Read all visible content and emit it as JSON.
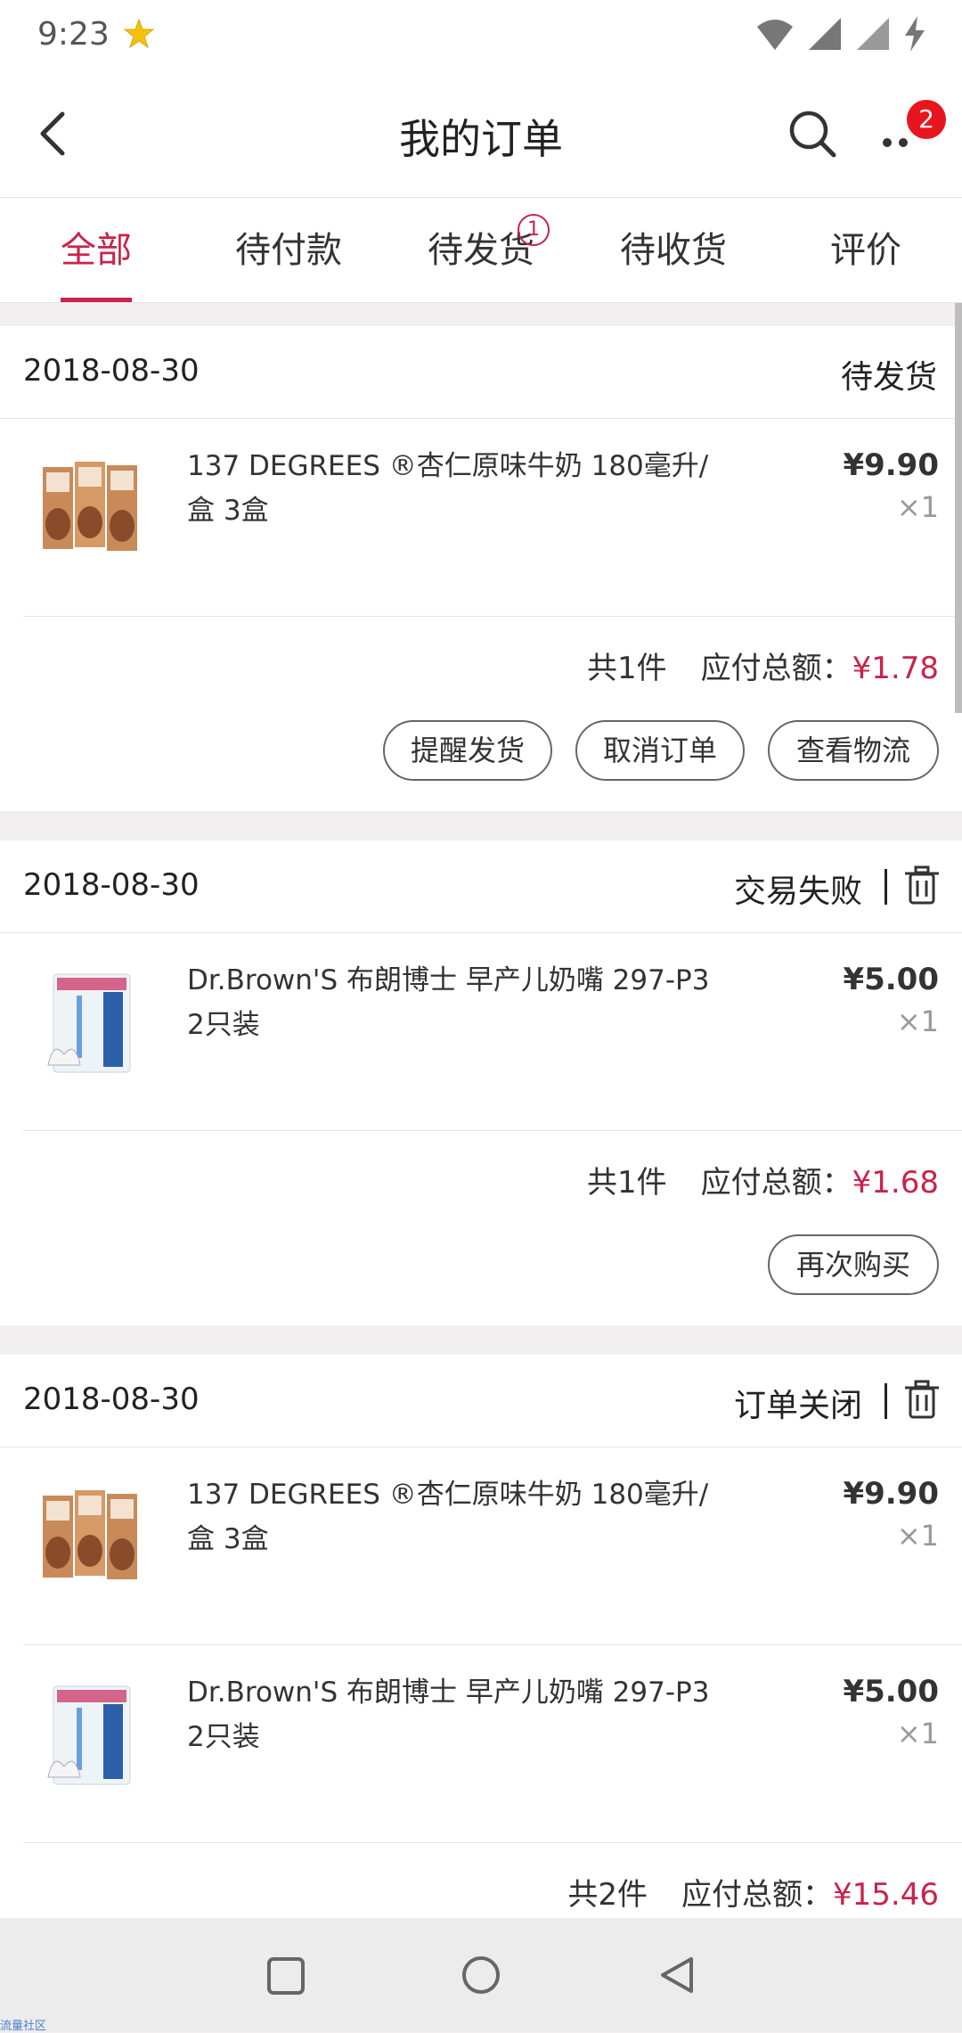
{
  "status_bar": {
    "time": "9:23",
    "notification_icon": "star-badge-icon"
  },
  "header": {
    "title": "我的订单",
    "more_badge": "2"
  },
  "tabs": [
    {
      "label": "全部",
      "active": true
    },
    {
      "label": "待付款"
    },
    {
      "label": "待发货",
      "badge": "1"
    },
    {
      "label": "待收货"
    },
    {
      "label": "评价"
    }
  ],
  "orders": [
    {
      "date": "2018-08-30",
      "status": "待发货",
      "items": [
        {
          "name": "137 DEGREES ®杏仁原味牛奶 180毫升/盒 3盒",
          "price": "¥9.90",
          "qty": "×1",
          "thumb": "almond-milk-thumb"
        }
      ],
      "count_text": "共1件",
      "total_label": "应付总额：",
      "total": "¥1.78",
      "buttons": [
        "提醒发货",
        "取消订单",
        "查看物流"
      ]
    },
    {
      "date": "2018-08-30",
      "status": "交易失败",
      "items": [
        {
          "name": "Dr.Brown'S 布朗博士 早产儿奶嘴 297-P3 2只装",
          "price": "¥5.00",
          "qty": "×1",
          "thumb": "nipple-pack-thumb"
        }
      ],
      "count_text": "共1件",
      "total_label": "应付总额：",
      "total": "¥1.68",
      "buttons": [
        "再次购买"
      ]
    },
    {
      "date": "2018-08-30",
      "status": "订单关闭",
      "items": [
        {
          "name": "137 DEGREES ®杏仁原味牛奶 180毫升/盒 3盒",
          "price": "¥9.90",
          "qty": "×1",
          "thumb": "almond-milk-thumb"
        },
        {
          "name": "Dr.Brown'S 布朗博士 早产儿奶嘴 297-P3 2只装",
          "price": "¥5.00",
          "qty": "×1",
          "thumb": "nipple-pack-thumb"
        }
      ],
      "count_text": "共2件",
      "total_label": "应付总额：",
      "total": "¥15.46",
      "buttons": []
    }
  ],
  "watermark": "流量社区",
  "colors": {
    "accent": "#c8234a",
    "badge_red": "#e8151f"
  }
}
